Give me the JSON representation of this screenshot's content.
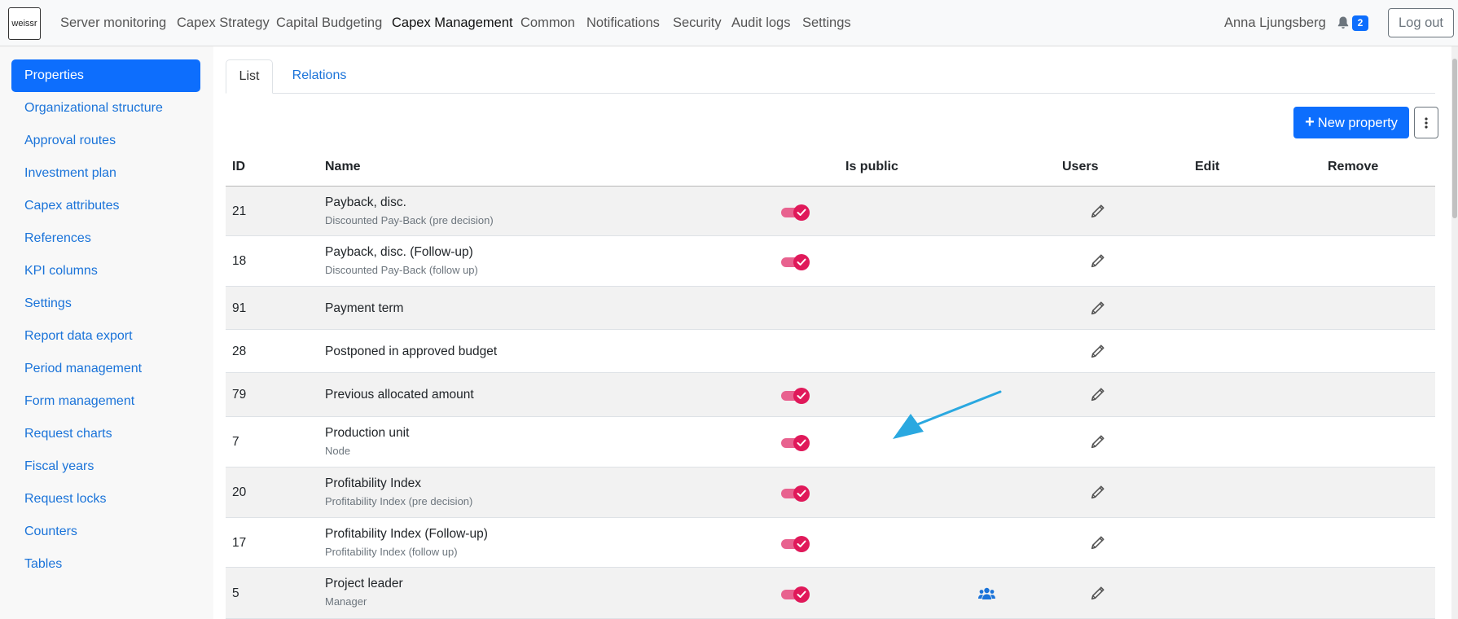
{
  "topbar": {
    "logo_text": "weissr",
    "nav": [
      "Server monitoring",
      "Capex Strategy",
      "Capital Budgeting",
      "Capex Management",
      "Common",
      "Notifications",
      "Security",
      "Audit logs",
      "Settings"
    ],
    "active_nav": "Capex Management",
    "user_name": "Anna Ljungsberg",
    "notification_count": "2",
    "logout_label": "Log out"
  },
  "sidebar": {
    "items": [
      "Properties",
      "Organizational structure",
      "Approval routes",
      "Investment plan",
      "Capex attributes",
      "References",
      "KPI columns",
      "Settings",
      "Report data export",
      "Period management",
      "Form management",
      "Request charts",
      "Fiscal years",
      "Request locks",
      "Counters",
      "Tables"
    ],
    "active_item": "Properties"
  },
  "tabs": {
    "list": "List",
    "relations": "Relations",
    "active": "List"
  },
  "toolbar": {
    "new_property_label": "New property"
  },
  "table": {
    "headers": {
      "id": "ID",
      "name": "Name",
      "is_public": "Is public",
      "users": "Users",
      "edit": "Edit",
      "remove": "Remove"
    },
    "rows": [
      {
        "id": "21",
        "name": "Payback, disc.",
        "subtitle": "Discounted Pay-Back (pre decision)",
        "is_public": true,
        "has_users": false
      },
      {
        "id": "18",
        "name": "Payback, disc. (Follow-up)",
        "subtitle": "Discounted Pay-Back (follow up)",
        "is_public": true,
        "has_users": false
      },
      {
        "id": "91",
        "name": "Payment term",
        "subtitle": "",
        "is_public": false,
        "has_users": false
      },
      {
        "id": "28",
        "name": "Postponed in approved budget",
        "subtitle": "",
        "is_public": false,
        "has_users": false
      },
      {
        "id": "79",
        "name": "Previous allocated amount",
        "subtitle": "",
        "is_public": true,
        "has_users": false
      },
      {
        "id": "7",
        "name": "Production unit",
        "subtitle": "Node",
        "is_public": true,
        "has_users": false
      },
      {
        "id": "20",
        "name": "Profitability Index",
        "subtitle": "Profitability Index (pre decision)",
        "is_public": true,
        "has_users": false
      },
      {
        "id": "17",
        "name": "Profitability Index (Follow-up)",
        "subtitle": "Profitability Index (follow up)",
        "is_public": true,
        "has_users": false
      },
      {
        "id": "5",
        "name": "Project leader",
        "subtitle": "Manager",
        "is_public": true,
        "has_users": true
      }
    ]
  },
  "colors": {
    "primary": "#0d6efd",
    "link": "#1a73d9",
    "toggle_on": "#e0195a",
    "annotation_arrow": "#2aa8e0"
  },
  "icons": {
    "bell": "bell-icon",
    "edit": "pencil-icon",
    "users": "users-icon",
    "more": "kebab-menu-icon",
    "add": "plus-icon"
  }
}
